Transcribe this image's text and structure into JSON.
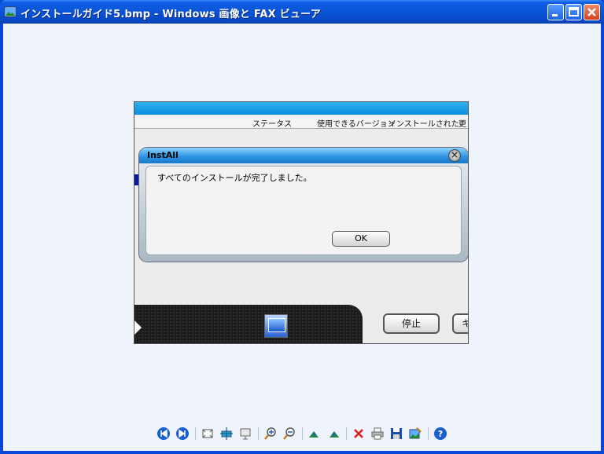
{
  "window": {
    "title": "インストールガイド5.bmp - Windows 画像と FAX ビューア",
    "app_icon": "image-viewer-icon",
    "controls": [
      "minimize-icon",
      "maximize-icon",
      "close-icon"
    ]
  },
  "image_content": {
    "columns": [
      "ステータス",
      "使用できるバージョン",
      "インストールされた",
      "更"
    ],
    "stop_button_label": "停止",
    "second_button_label": "キ",
    "dialog": {
      "title": "InstAll",
      "message": "すべてのインストールが完了しました。",
      "ok_label": "OK"
    }
  },
  "toolbar": {
    "items": [
      "previous-image-icon",
      "next-image-icon",
      "best-fit-icon",
      "actual-size-icon",
      "slideshow-icon",
      "zoom-in-icon",
      "zoom-out-icon",
      "rotate-clockwise-icon",
      "rotate-counterclockwise-icon",
      "delete-icon",
      "print-icon",
      "save-icon",
      "edit-icon",
      "help-icon"
    ]
  },
  "colors": {
    "titlebar": "#0a54d6",
    "client_bg": "#eef3fc",
    "dialog_title": "#2a90e0"
  }
}
